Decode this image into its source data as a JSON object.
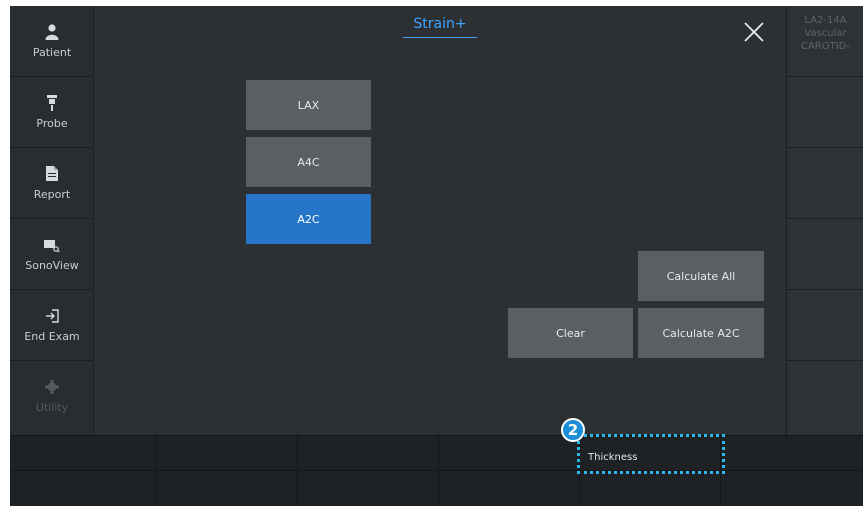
{
  "sidebar": {
    "items": [
      {
        "label": "Patient",
        "icon": "person-icon"
      },
      {
        "label": "Probe",
        "icon": "probe-icon"
      },
      {
        "label": "Report",
        "icon": "document-icon"
      },
      {
        "label": "SonoView",
        "icon": "sonoview-icon"
      },
      {
        "label": "End Exam",
        "icon": "exit-icon"
      },
      {
        "label": "Utility",
        "icon": "gear-icon",
        "disabled": true
      }
    ]
  },
  "right_panel": {
    "probe": "LA2-14A",
    "app": "Vascular",
    "preset": "CAROTID-"
  },
  "header": {
    "title": "Strain+"
  },
  "views": {
    "buttons": [
      "LAX",
      "A4C",
      "A2C"
    ],
    "selected": "A2C"
  },
  "actions": {
    "calculate_all": "Calculate All",
    "clear": "Clear",
    "calculate_a2c": "Calculate A2C"
  },
  "bottom_bar": {
    "thickness_label": "Thickness",
    "callout_number": "2"
  },
  "colors": {
    "accent": "#3ea3ff",
    "selected": "#2675c9",
    "callout": "#2db6ef"
  }
}
